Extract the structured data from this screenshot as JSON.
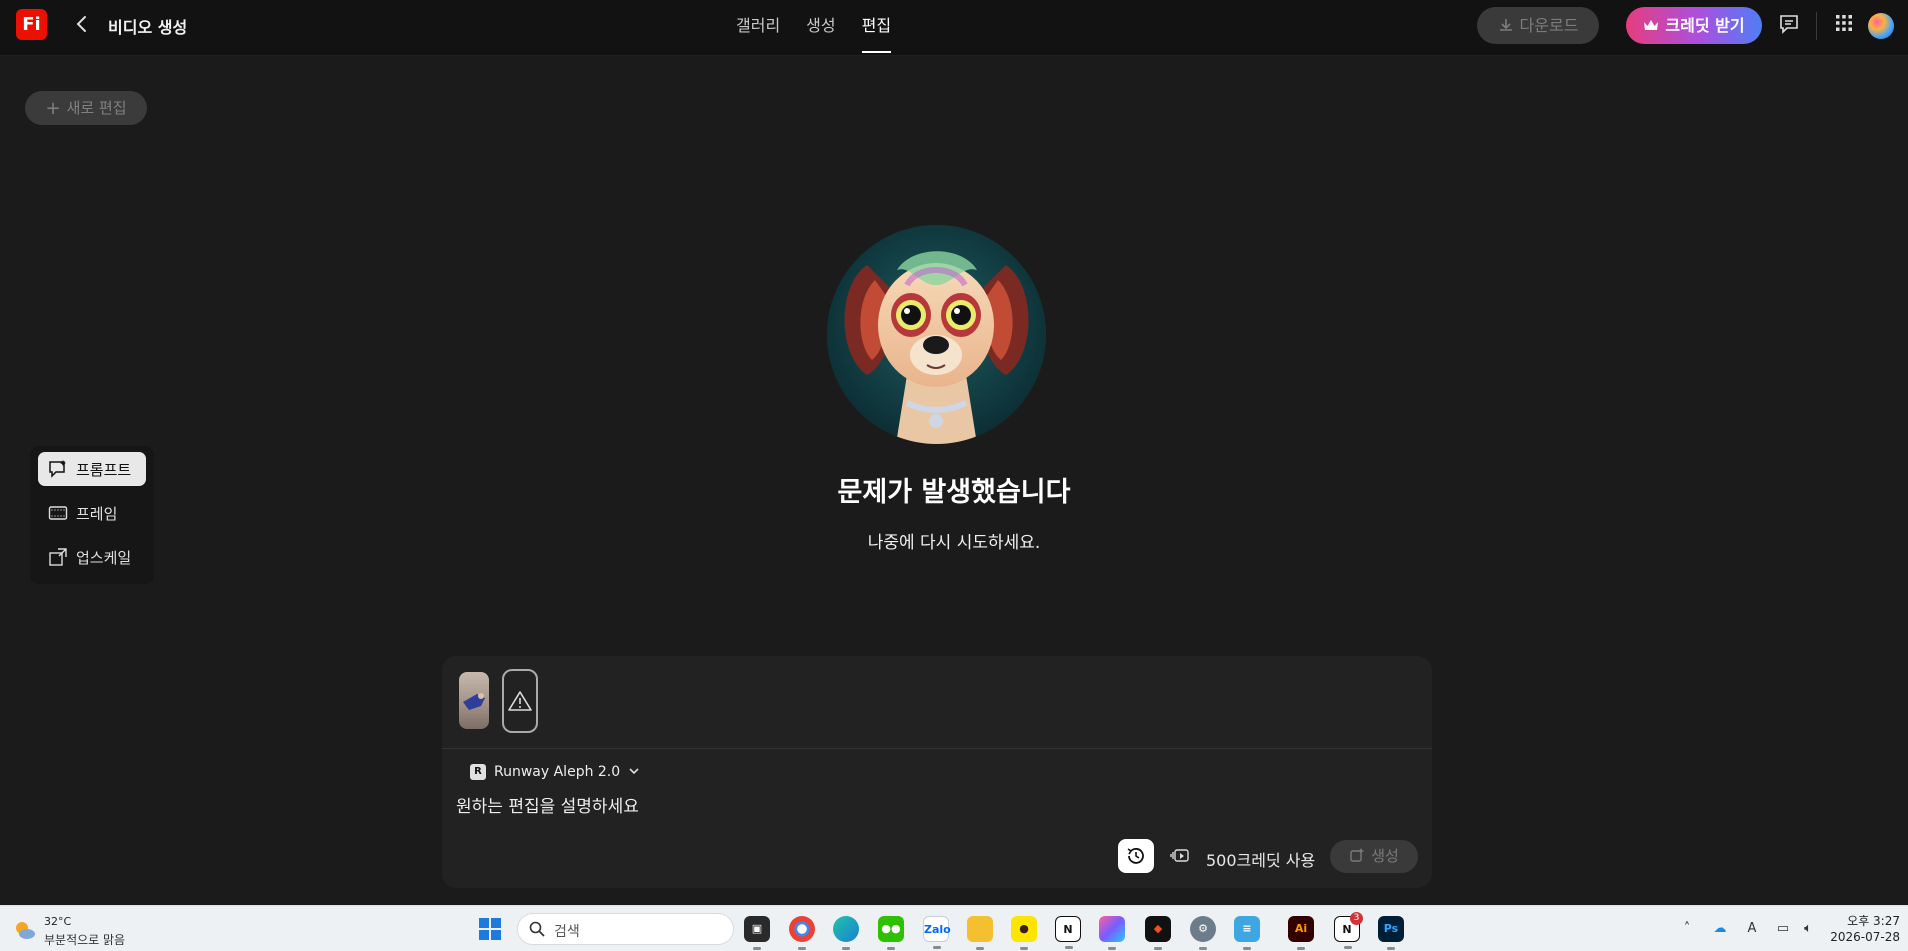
{
  "header": {
    "logo_text": "Fi",
    "back_label": "‹",
    "title": "비디오 생성",
    "tabs": [
      {
        "label": "갤러리",
        "active": false
      },
      {
        "label": "생성",
        "active": false
      },
      {
        "label": "편집",
        "active": true
      }
    ],
    "download_label": "다운로드",
    "credit_label": "크레딧 받기"
  },
  "new_edit_label": "새로 편집",
  "tools": [
    {
      "label": "프롬프트",
      "icon": "prompt-icon",
      "active": true
    },
    {
      "label": "프레임",
      "icon": "frame-icon",
      "active": false
    },
    {
      "label": "업스케일",
      "icon": "upscale-icon",
      "active": false
    }
  ],
  "error": {
    "title": "문제가 발생했습니다",
    "subtitle": "나중에 다시 시도하세요."
  },
  "prompt": {
    "model_name": "Runway Aleph 2.0",
    "placeholder": "원하는 편집을 설명하세요",
    "credits_label": "500크레딧 사용",
    "generate_label": "생성"
  },
  "taskbar": {
    "weather_temp": "32°C",
    "weather_condition": "부분적으로 맑음",
    "search_placeholder": "검색",
    "time": "오후 3:27",
    "date": "2026-07-28",
    "notification_badge": "3"
  },
  "colors": {
    "background": "#1b1b1b",
    "header": "#121212",
    "brand": "#eb1000",
    "credit_gradient_start": "#e63d7e",
    "credit_gradient_end": "#4f7ef5"
  }
}
